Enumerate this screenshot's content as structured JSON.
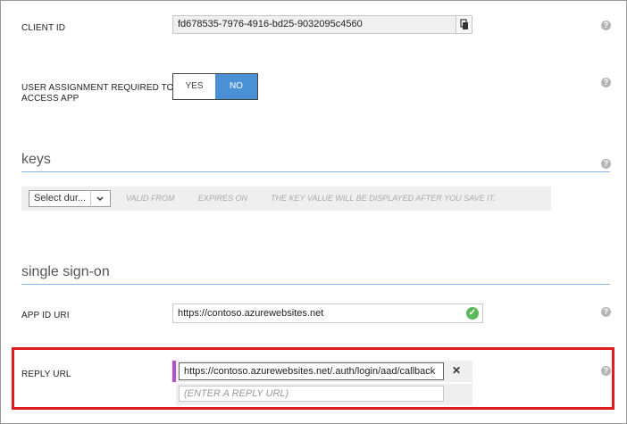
{
  "client_id": {
    "label": "CLIENT ID",
    "value": "fd678535-7976-4916-bd25-9032095c4560"
  },
  "user_assignment": {
    "label_line1": "USER ASSIGNMENT REQUIRED TO",
    "label_line2": "ACCESS APP",
    "yes": "YES",
    "no": "NO",
    "selected": "NO"
  },
  "keys": {
    "title": "keys",
    "select_label": "Select dur...",
    "valid_from": "VALID FROM",
    "expires_on": "EXPIRES ON",
    "key_value_note": "THE KEY VALUE WILL BE DISPLAYED AFTER YOU SAVE IT."
  },
  "sso": {
    "title": "single sign-on",
    "app_id_label": "APP ID URI",
    "app_id_value": "https://contoso.azurewebsites.net",
    "reply_label": "REPLY URL",
    "reply_value": "https://contoso.azurewebsites.net/.auth/login/aad/callback",
    "reply_placeholder": "(ENTER A REPLY URL)"
  },
  "icons": {
    "help": "?",
    "close": "✕",
    "check": "✓",
    "copy": "copy-icon",
    "chevron": "chevron-down-icon"
  },
  "colors": {
    "accent": "#4a90d4",
    "highlight_border": "#e21b23",
    "focus_marker": "#b84fcf",
    "success": "#5bb85b"
  }
}
